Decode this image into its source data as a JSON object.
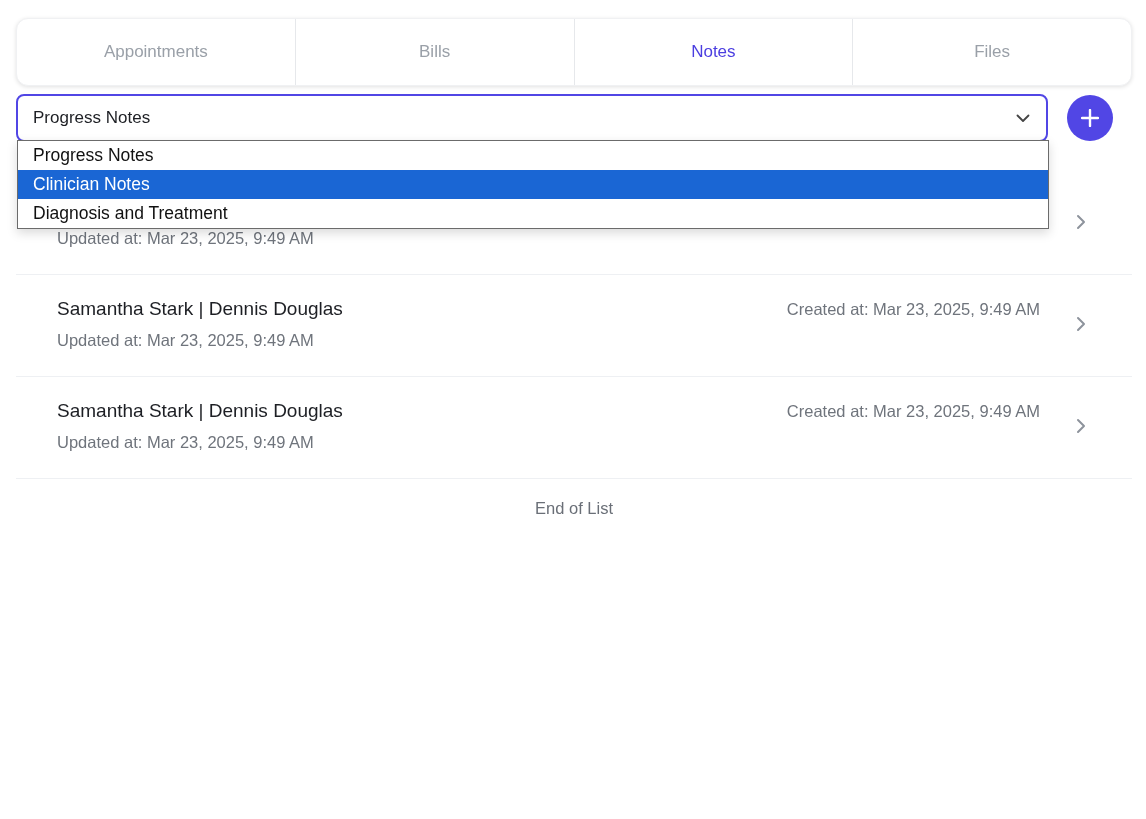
{
  "tabs": [
    {
      "label": "Appointments",
      "selected": false
    },
    {
      "label": "Bills",
      "selected": false
    },
    {
      "label": "Notes",
      "selected": true
    },
    {
      "label": "Files",
      "selected": false
    }
  ],
  "note_type_select": {
    "value": "Progress Notes",
    "expanded": true,
    "options": [
      {
        "label": "Progress Notes",
        "highlighted": false
      },
      {
        "label": "Clinician Notes",
        "highlighted": true
      },
      {
        "label": "Diagnosis and Treatment",
        "highlighted": false
      }
    ]
  },
  "notes": [
    {
      "updated": "Updated at: Mar 23, 2025, 9:49 AM"
    },
    {
      "title": "Samantha Stark | Dennis Douglas",
      "created": "Created at: Mar 23, 2025, 9:49 AM",
      "updated": "Updated at: Mar 23, 2025, 9:49 AM"
    },
    {
      "title": "Samantha Stark | Dennis Douglas",
      "created": "Created at: Mar 23, 2025, 9:49 AM",
      "updated": "Updated at: Mar 23, 2025, 9:49 AM"
    }
  ],
  "end_of_list": "End of List"
}
